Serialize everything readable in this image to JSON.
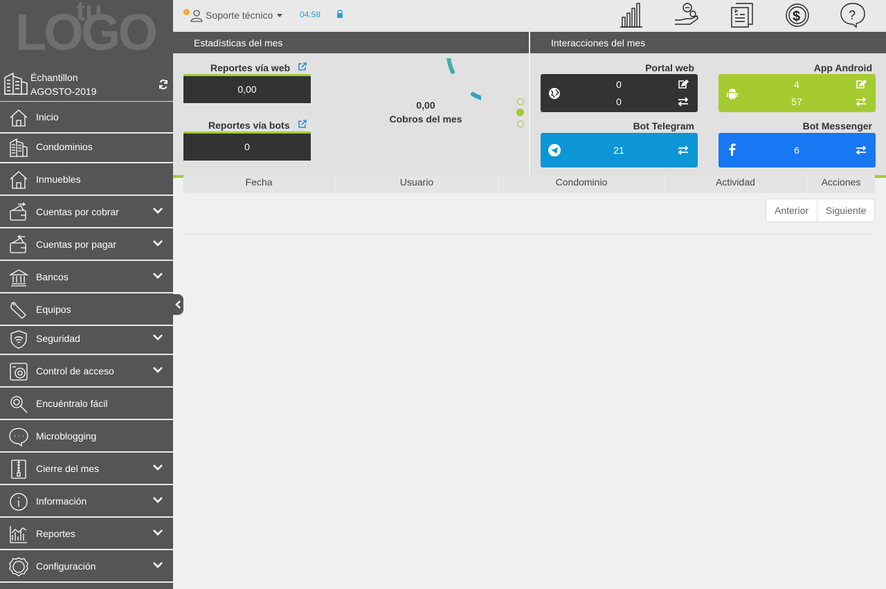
{
  "logo": {
    "main": "LOGO",
    "small": "tu"
  },
  "account": {
    "name": "Échantillon",
    "period": "AGOSTO-2019"
  },
  "sidebar": {
    "items": [
      {
        "label": "Inicio",
        "icon": "home-icon",
        "has_children": false
      },
      {
        "label": "Condominios",
        "icon": "buildings-icon",
        "has_children": false
      },
      {
        "label": "Inmuebles",
        "icon": "house-icon",
        "has_children": false
      },
      {
        "label": "Cuentas por cobrar",
        "icon": "wallet-in-icon",
        "has_children": true
      },
      {
        "label": "Cuentas por pagar",
        "icon": "wallet-out-icon",
        "has_children": true
      },
      {
        "label": "Bancos",
        "icon": "bank-icon",
        "has_children": true
      },
      {
        "label": "Equipos",
        "icon": "wrench-icon",
        "has_children": false
      },
      {
        "label": "Seguridad",
        "icon": "shield-wifi-icon",
        "has_children": true
      },
      {
        "label": "Control de acceso",
        "icon": "access-camera-icon",
        "has_children": true
      },
      {
        "label": "Encuéntralo fácil",
        "icon": "magnifier-icon",
        "has_children": false
      },
      {
        "label": "Microblogging",
        "icon": "chat-bubble-icon",
        "has_children": false
      },
      {
        "label": "Cierre del mes",
        "icon": "zipper-file-icon",
        "has_children": true
      },
      {
        "label": "Información",
        "icon": "info-icon",
        "has_children": true
      },
      {
        "label": "Reportes",
        "icon": "report-chart-icon",
        "has_children": true
      },
      {
        "label": "Configuración",
        "icon": "settings-gear-icon",
        "has_children": true
      }
    ]
  },
  "topbar": {
    "user": "Soporte técnico",
    "clock": "04:58",
    "icons": [
      "bar-chart-icon",
      "hand-coins-icon",
      "invoice-icon",
      "dollar-coin-icon",
      "help-bubble-icon"
    ]
  },
  "stats": {
    "title": "Estadísticas del mes",
    "web_label": "Reportes vía web",
    "web_value": "0,00",
    "bots_label": "Reportes vía bots",
    "bots_value": "0",
    "ring_value": "0,00",
    "ring_label": "Cobros del mes"
  },
  "interactions": {
    "title": "Interacciones del mes",
    "portal": {
      "title": "Portal web",
      "edits": "0",
      "transfers": "0"
    },
    "android": {
      "title": "App Android",
      "edits": "4",
      "transfers": "57"
    },
    "telegram": {
      "title": "Bot Telegram",
      "value": "21"
    },
    "messenger": {
      "title": "Bot Messenger",
      "value": "6"
    }
  },
  "table": {
    "columns": [
      "Fecha",
      "Usuario",
      "Condominio",
      "Actividad",
      "Acciones"
    ],
    "prev": "Anterior",
    "next": "Siguiente"
  },
  "colors": {
    "accent_green": "#a6cb31",
    "sidebar": "#555555",
    "telegram": "#0d96d6",
    "messenger": "#1877f2",
    "clock": "#2c9fd6"
  }
}
